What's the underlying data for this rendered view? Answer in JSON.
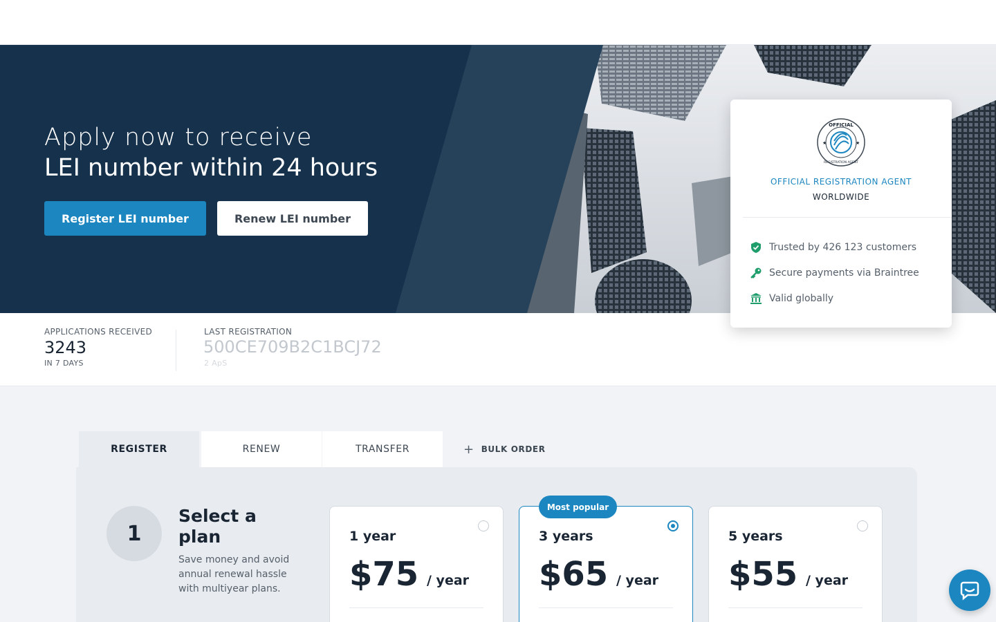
{
  "hero": {
    "headline_line1": "Apply now to receive",
    "headline_line2": "LEI number within 24 hours",
    "primary_button": "Register LEI number",
    "secondary_button": "Renew LEI number"
  },
  "agent_card": {
    "seal_text_top": "OFFICIAL",
    "seal_text_bottom": "REGISTRATION AGENT",
    "title": "OFFICIAL REGISTRATION AGENT",
    "subtitle": "WORLDWIDE",
    "features": [
      {
        "icon": "shield-check-icon",
        "text": "Trusted by 426 123 customers"
      },
      {
        "icon": "key-icon",
        "text": "Secure payments via Braintree"
      },
      {
        "icon": "bank-icon",
        "text": "Valid globally"
      }
    ]
  },
  "stats": {
    "applications": {
      "label": "APPLICATIONS RECEIVED",
      "value": "3243",
      "sub": "IN 7 DAYS"
    },
    "last_registration": {
      "label": "LAST REGISTRATION",
      "value": "500CE709B2C1BCJ72",
      "sub": "2 ApS"
    }
  },
  "tabs": [
    {
      "label": "REGISTER",
      "active": true
    },
    {
      "label": "RENEW",
      "active": false
    },
    {
      "label": "TRANSFER",
      "active": false
    }
  ],
  "bulk_order": {
    "label": "BULK ORDER"
  },
  "step": {
    "number": "1",
    "title": "Select a plan",
    "description": "Save money and avoid annual renewal hassle with multiyear plans."
  },
  "plans": [
    {
      "name": "1 year",
      "price": "$75",
      "per": "/ year",
      "selected": false
    },
    {
      "name": "3 years",
      "price": "$65",
      "per": "/ year",
      "selected": true,
      "badge": "Most popular"
    },
    {
      "name": "5 years",
      "price": "$55",
      "per": "/ year",
      "selected": false
    }
  ],
  "colors": {
    "brand_blue": "#1b86c0",
    "hero_navy": "#15314b",
    "feature_green": "#1f9d6b"
  }
}
